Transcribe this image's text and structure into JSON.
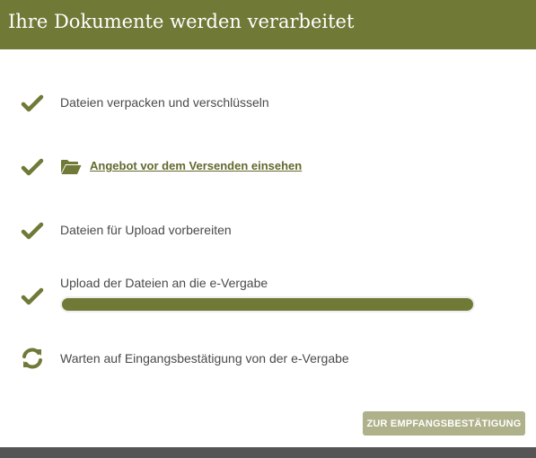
{
  "dialog": {
    "title": "Ihre Dokumente werden verarbeitet"
  },
  "steps": [
    {
      "status": "done",
      "icon": "checkmark-icon",
      "label": "Dateien verpacken und verschlüsseln"
    },
    {
      "status": "done",
      "icon": "checkmark-icon",
      "secondary_icon": "folder-open-icon",
      "label": "Angebot vor dem Versenden einsehen",
      "is_link": true
    },
    {
      "status": "done",
      "icon": "checkmark-icon",
      "label": "Dateien für Upload vorbereiten"
    },
    {
      "status": "done",
      "icon": "checkmark-icon",
      "label": "Upload der Dateien an die e-Vergabe",
      "progress": 1.0
    },
    {
      "status": "in-progress",
      "icon": "refresh-icon",
      "label": "Warten auf Eingangsbestätigung von der e-Vergabe"
    }
  ],
  "actions": {
    "confirm_label": "ZUR  EMPFANGSBESTÄTIGUNG",
    "confirm_enabled": false
  },
  "colors": {
    "accent": "#717936",
    "link": "#626a2c",
    "button_disabled": "#aeb189"
  }
}
